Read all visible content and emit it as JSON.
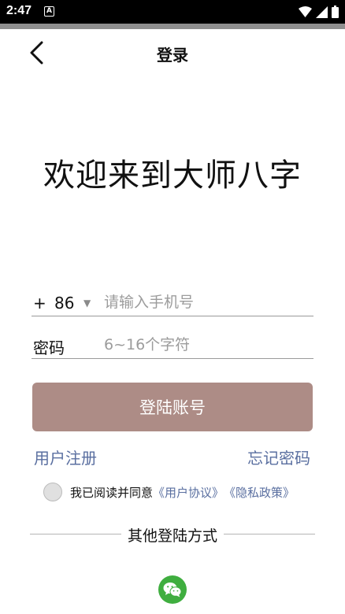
{
  "status_bar": {
    "time": "2:47",
    "notification_letter": "A",
    "icons": [
      "wifi-icon",
      "signal-icon",
      "battery-icon"
    ]
  },
  "nav": {
    "back_icon": "chevron-left-icon",
    "title": "登录"
  },
  "welcome": "欢迎来到大师八字",
  "phone": {
    "prefix_plus": "+",
    "country_code": "86",
    "dropdown_icon": "triangle-down-icon",
    "placeholder": "请输入手机号",
    "value": ""
  },
  "password": {
    "label": "密码",
    "placeholder": "6~16个字符",
    "value": ""
  },
  "login_button": "登陆账号",
  "links": {
    "register": "用户注册",
    "forgot": "忘记密码"
  },
  "agreement": {
    "checked": false,
    "text": "我已阅读并同意",
    "user_agreement": "《用户协议》",
    "privacy_policy": "《隐私政策》"
  },
  "other_login": {
    "title": "其他登陆方式",
    "wechat_icon": "wechat-icon"
  },
  "colors": {
    "primary_button": "#ad8c86",
    "link": "#5a6fa0",
    "wechat": "#3fae3f"
  }
}
